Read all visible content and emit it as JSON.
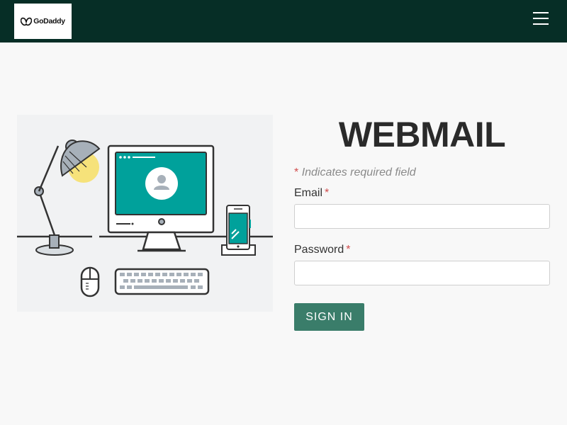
{
  "header": {
    "logo_text": "GoDaddy",
    "menu_icon": "hamburger-menu-icon",
    "background_color": "#062e26"
  },
  "illustration": {
    "icons": [
      "desk-lamp-icon",
      "computer-monitor-icon",
      "user-avatar-icon",
      "smartphone-icon",
      "mouse-icon",
      "keyboard-icon"
    ]
  },
  "form": {
    "title": "WEBMAIL",
    "required_star": "*",
    "required_note": "Indicates required field",
    "email_label": "Email",
    "email_value": "",
    "password_label": "Password",
    "password_value": "",
    "submit_label": "SIGN IN"
  },
  "colors": {
    "accent": "#3a7d6a",
    "teal_screen": "#00a19b",
    "required": "#d14d4d"
  }
}
